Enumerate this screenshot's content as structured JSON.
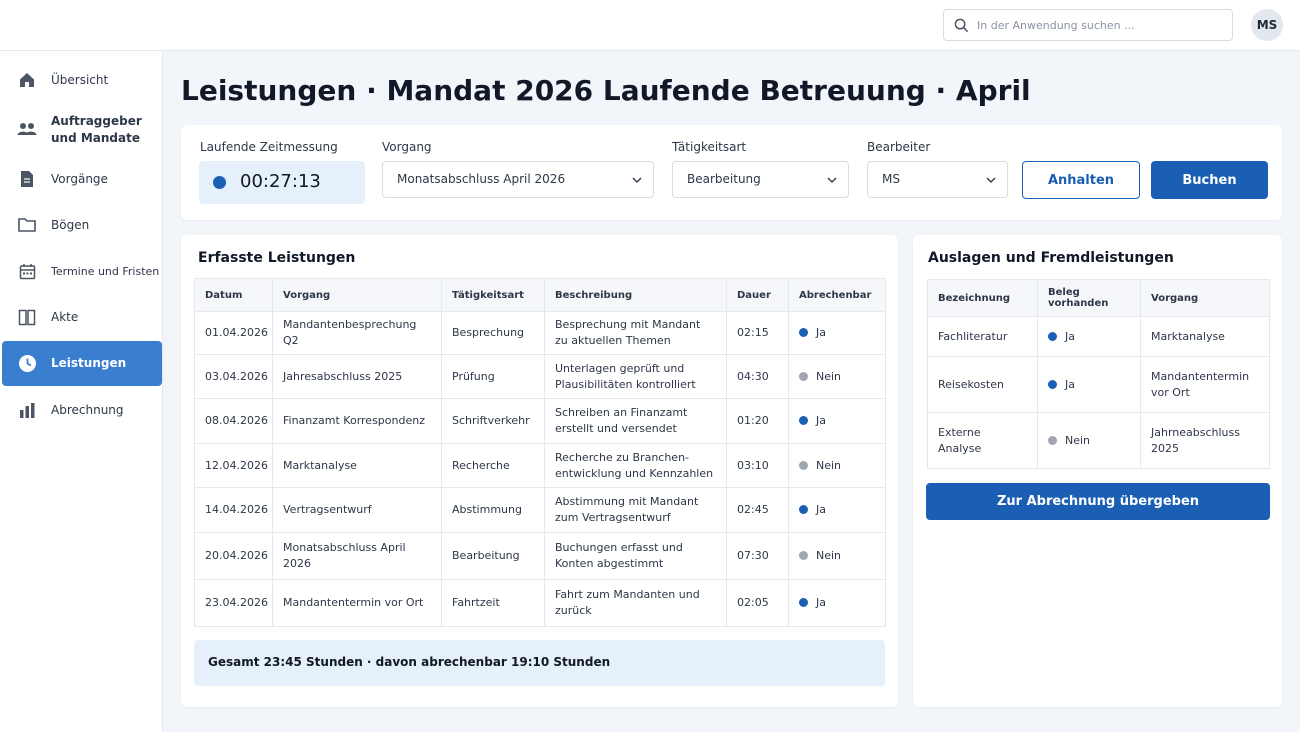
{
  "header": {
    "search_placeholder": "In der Anwendung suchen ...",
    "avatar_initials": "MS"
  },
  "sidebar": {
    "items": [
      {
        "label": "Übersicht",
        "icon": "home-icon"
      },
      {
        "label": "Auftraggeber\nund Mandate",
        "icon": "users-icon"
      },
      {
        "label": "Vorgänge",
        "icon": "document-icon"
      },
      {
        "label": "Bögen",
        "icon": "folder-icon"
      },
      {
        "label": "Termine und Fristen",
        "icon": "calendar-icon"
      },
      {
        "label": "Akte",
        "icon": "book-icon"
      },
      {
        "label": "Leistungen",
        "icon": "clock-icon",
        "active": true
      },
      {
        "label": "Abrechnung",
        "icon": "bar-chart-icon"
      }
    ]
  },
  "page": {
    "title": "Leistungen · Mandat 2026 Laufende Betreuung · April"
  },
  "timer_bar": {
    "timer_label": "Laufende Zeitmessung",
    "timer_value": "00:27:13",
    "vorgang_label": "Vorgang",
    "vorgang_value": "Monatsabschluss April 2026",
    "taetigkeit_label": "Tätigkeitsart",
    "taetigkeit_value": "Bearbeitung",
    "bearbeiter_label": "Bearbeiter",
    "bearbeiter_value": "MS",
    "pause_label": "Anhalten",
    "book_label": "Buchen"
  },
  "services": {
    "title": "Erfasste Leistungen",
    "columns": [
      "Datum",
      "Vorgang",
      "Tätigkeitsart",
      "Beschreibung",
      "Dauer",
      "Abrechenbar"
    ],
    "rows": [
      {
        "datum": "01.04.2026",
        "vorgang": "Mandantenbesprechung Q2",
        "taetigkeit": "Besprechung",
        "beschreibung": "Besprechung mit Mandant\nzu aktuellen Themen",
        "dauer": "02:15",
        "abrechenbar": "Ja"
      },
      {
        "datum": "03.04.2026",
        "vorgang": "Jahresabschluss 2025",
        "taetigkeit": "Prüfung",
        "beschreibung": "Unterlagen geprüft und\nPlausibilitäten kontrolliert",
        "dauer": "04:30",
        "abrechenbar": "Nein"
      },
      {
        "datum": "08.04.2026",
        "vorgang": "Finanzamt Korrespondenz",
        "taetigkeit": "Schriftverkehr",
        "beschreibung": "Schreiben an Finanzamt\nerstellt und versendet",
        "dauer": "01:20",
        "abrechenbar": "Ja"
      },
      {
        "datum": "12.04.2026",
        "vorgang": "Marktanalyse",
        "taetigkeit": "Recherche",
        "beschreibung": "Recherche zu Branchen-\nentwicklung und Kennzahlen",
        "dauer": "03:10",
        "abrechenbar": "Nein"
      },
      {
        "datum": "14.04.2026",
        "vorgang": "Vertragsentwurf",
        "taetigkeit": "Abstimmung",
        "beschreibung": "Abstimmung mit Mandant\nzum Vertragsentwurf",
        "dauer": "02:45",
        "abrechenbar": "Ja"
      },
      {
        "datum": "20.04.2026",
        "vorgang": "Monatsabschluss April 2026",
        "taetigkeit": "Bearbeitung",
        "beschreibung": "Buchungen erfasst und\nKonten abgestimmt",
        "dauer": "07:30",
        "abrechenbar": "Nein"
      },
      {
        "datum": "23.04.2026",
        "vorgang": "Mandantentermin vor Ort",
        "taetigkeit": "Fahrtzeit",
        "beschreibung": "Fahrt zum Mandanten und\nzurück",
        "dauer": "02:05",
        "abrechenbar": "Ja"
      }
    ],
    "total_text": "Gesamt  23:45 Stunden · davon abrechenbar  19:10 Stunden"
  },
  "expenses": {
    "title": "Auslagen und Fremdleistungen",
    "columns": [
      "Bezeichnung",
      "Beleg vorhanden",
      "Vorgang"
    ],
    "rows": [
      {
        "bezeichnung": "Fachliteratur",
        "beleg": "Ja",
        "vorgang": "Marktanalyse"
      },
      {
        "bezeichnung": "Reisekosten",
        "beleg": "Ja",
        "vorgang": "Mandantentermin\nvor Ort"
      },
      {
        "bezeichnung": "Externe Analyse",
        "beleg": "Nein",
        "vorgang": "Jahrneabschluss\n2025"
      }
    ],
    "submit_label": "Zur Abrechnung übergeben"
  },
  "colors": {
    "yes": "#1a5fb4",
    "no": "#a0a7b1",
    "accent": "#1a5fb4",
    "active_nav": "#3a7ed0"
  }
}
